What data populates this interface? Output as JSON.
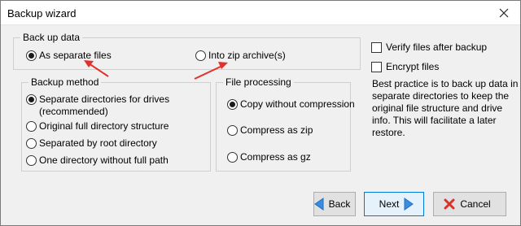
{
  "window": {
    "title": "Backup wizard"
  },
  "backup_up_data": {
    "legend": "Back up data",
    "options": [
      "As separate files",
      "Into zip archive(s)"
    ],
    "selected": 0
  },
  "backup_method": {
    "legend": "Backup method",
    "options": [
      "Separate directories for drives",
      "(recommended)",
      "Original full directory structure",
      "Separated by root directory",
      "One directory without full path"
    ],
    "selected": 0
  },
  "file_processing": {
    "legend": "File processing",
    "options": [
      "Copy without compression",
      "Compress as zip",
      "Compress as gz"
    ],
    "selected": 0
  },
  "checks": {
    "verify": "Verify files after backup",
    "encrypt": "Encrypt files"
  },
  "note": "Best practice is to back up data in separate directories to keep the original file structure and drive info. This will facilitate a later restore.",
  "buttons": {
    "back": "Back",
    "next": "Next",
    "cancel": "Cancel"
  },
  "colors": {
    "arrow": "#e0322c",
    "nav_arrow": "#3a8dde",
    "cancel_icon": "#d9342b"
  }
}
